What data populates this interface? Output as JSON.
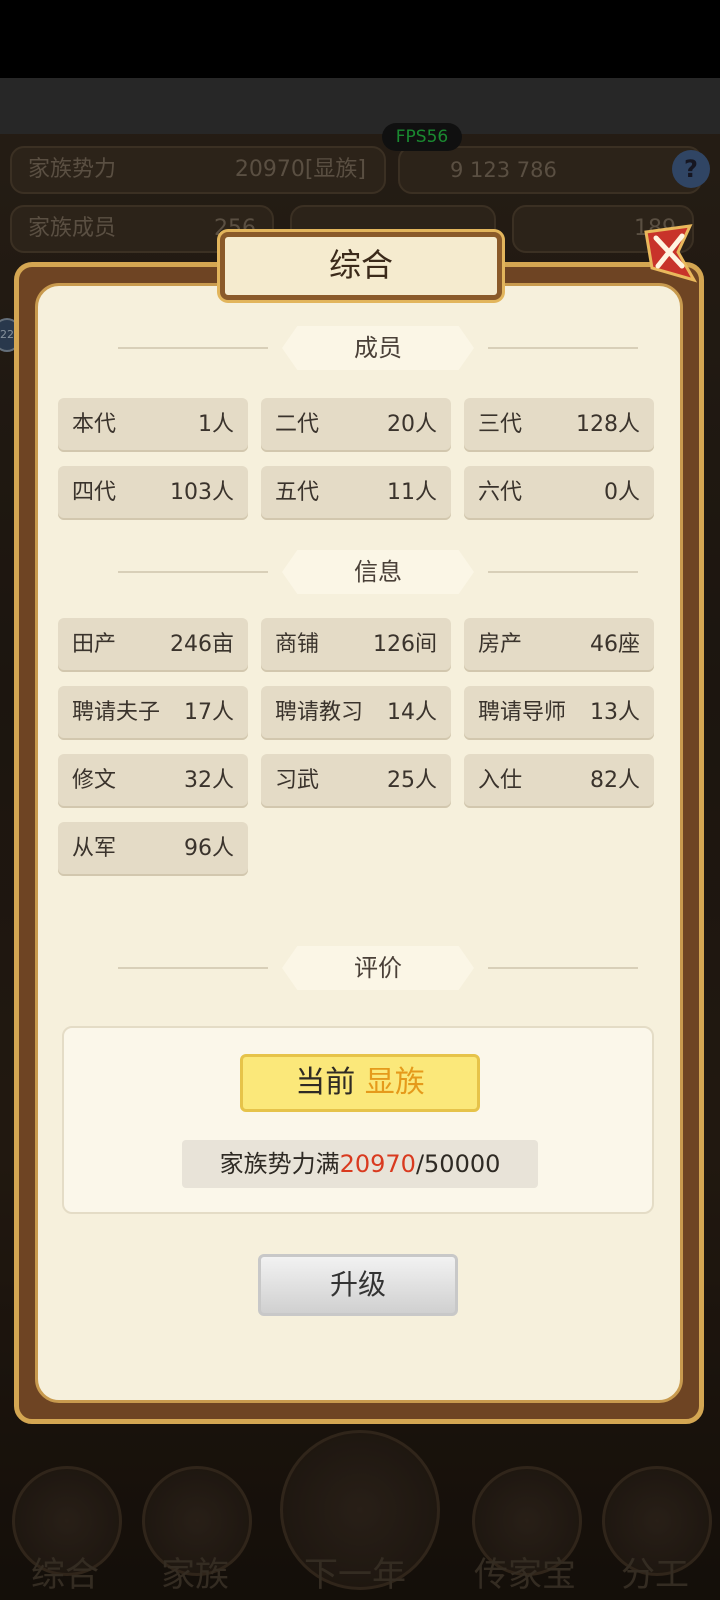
{
  "hud": {
    "fps": "FPS56",
    "power_label": "家族势力",
    "power_value": "20970[显族]",
    "resources": "9 123 786",
    "members_label": "家族成员",
    "members_value": "256",
    "gold_value": "189",
    "side_badge": "22"
  },
  "dialog": {
    "title": "综合",
    "sections": {
      "members": "成员",
      "info": "信息",
      "evaluation": "评价"
    },
    "members": [
      {
        "label": "本代",
        "value": "1人"
      },
      {
        "label": "二代",
        "value": "20人"
      },
      {
        "label": "三代",
        "value": "128人"
      },
      {
        "label": "四代",
        "value": "103人"
      },
      {
        "label": "五代",
        "value": "11人"
      },
      {
        "label": "六代",
        "value": "0人"
      }
    ],
    "info": [
      {
        "label": "田产",
        "value": "246亩"
      },
      {
        "label": "商铺",
        "value": "126间"
      },
      {
        "label": "房产",
        "value": "46座"
      },
      {
        "label": "聘请夫子",
        "value": "17人"
      },
      {
        "label": "聘请教习",
        "value": "14人"
      },
      {
        "label": "聘请导师",
        "value": "13人"
      },
      {
        "label": "修文",
        "value": "32人"
      },
      {
        "label": "习武",
        "value": "25人"
      },
      {
        "label": "入仕",
        "value": "82人"
      },
      {
        "label": "从军",
        "value": "96人"
      }
    ],
    "evaluation": {
      "current_prefix": "当前",
      "current_rank": "显族",
      "progress_prefix": "家族势力满",
      "progress_current": "20970",
      "progress_max": "/50000"
    },
    "upgrade_label": "升级"
  },
  "bottom_nav": [
    {
      "label": "综合"
    },
    {
      "label": "家族"
    },
    {
      "label": "下一年"
    },
    {
      "label": "传家宝"
    },
    {
      "label": "分工"
    }
  ],
  "colors": {
    "frame": "#6e4423",
    "panel": "#f6f0dc",
    "cell": "#e4dbc6",
    "rank_accent": "#e59a1b",
    "progress_accent": "#d93a1f"
  }
}
